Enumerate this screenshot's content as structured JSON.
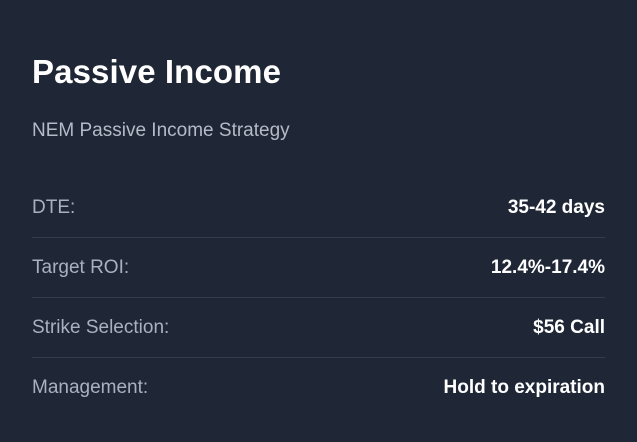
{
  "card": {
    "title": "Passive Income",
    "subtitle": "NEM Passive Income Strategy",
    "rows": [
      {
        "label": "DTE:",
        "value": "35-42 days"
      },
      {
        "label": "Target ROI:",
        "value": "12.4%-17.4%"
      },
      {
        "label": "Strike Selection:",
        "value": "$56 Call"
      },
      {
        "label": "Management:",
        "value": "Hold to expiration"
      }
    ]
  },
  "colors": {
    "background": "#1f2737",
    "title": "#ffffff",
    "label": "#aab1be",
    "value": "#ffffff",
    "divider": "#333c4c"
  }
}
